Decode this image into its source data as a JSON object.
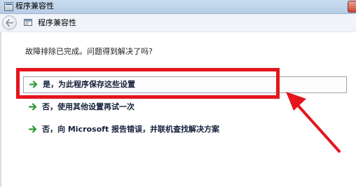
{
  "window": {
    "title": "程序兼容性"
  },
  "nav": {
    "title": "程序兼容性"
  },
  "prompt": "故障排除已完成。问题得到解决了吗?",
  "options": [
    {
      "label": "是，为此程序保存这些设置",
      "selected": true
    },
    {
      "label": "否，使用其他设置再试一次",
      "selected": false
    },
    {
      "label": "否，向 Microsoft 报告错误，并联机查找解决方案",
      "selected": false
    }
  ],
  "colors": {
    "annotation_red": "#e4161c",
    "arrow_green": "#2e9a37"
  }
}
